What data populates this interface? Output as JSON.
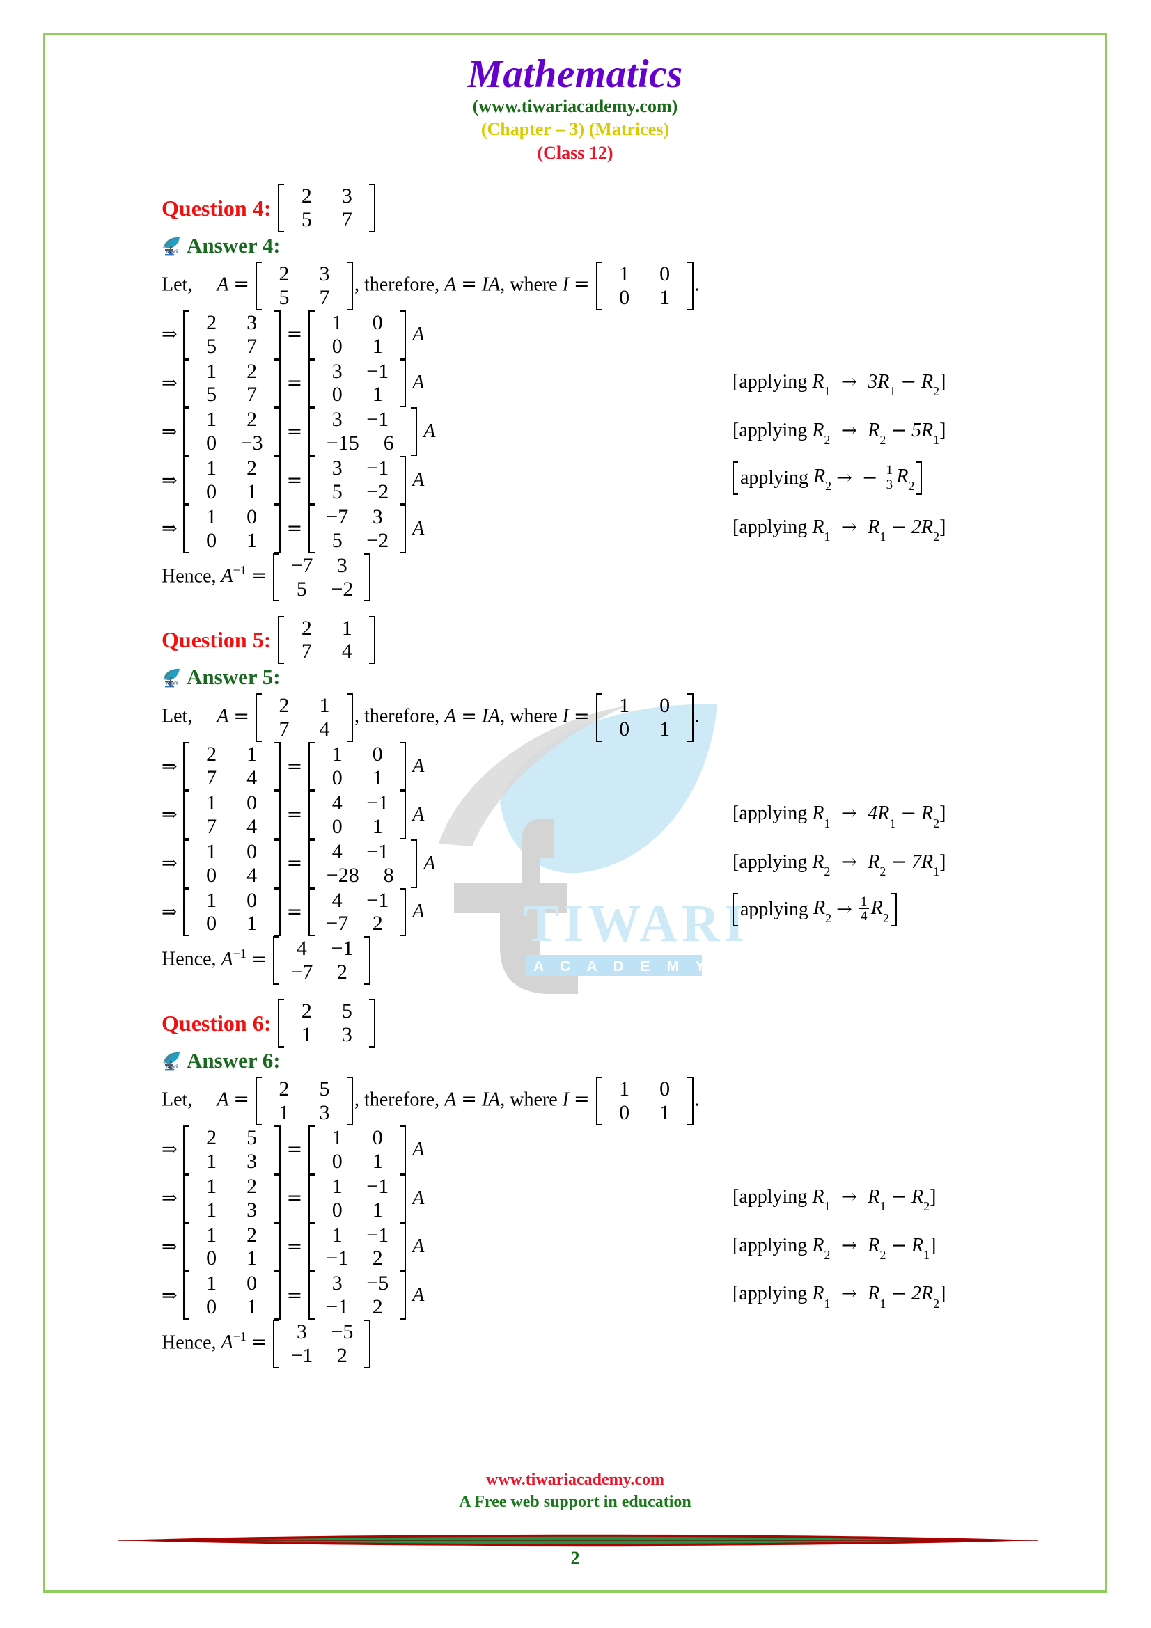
{
  "header": {
    "title": "Mathematics",
    "site": "(www.tiwariacademy.com)",
    "chapter": "(Chapter – 3) (Matrices)",
    "klass": "(Class 12)"
  },
  "colors": {
    "title_purple": "#6600cc",
    "site_green": "#1a6b1a",
    "chapter_yellow": "#d9cb00",
    "class_red": "#e8152b",
    "question_red": "#f01010",
    "answer_green": "#18691f",
    "page_border_green": "#8fce5c",
    "watermark_blue": "#cfeaf7",
    "watermark_gray": "#d4d4d4"
  },
  "watermark": {
    "brand": "TIWARI",
    "sub": "A C A D E M Y"
  },
  "sections": [
    {
      "question_label": "Question 4:",
      "question_matrix": [
        [
          "2",
          "3"
        ],
        [
          "5",
          "7"
        ]
      ],
      "answer_label": "Answer 4:",
      "let_text": "Let,",
      "A_sym": "A",
      "eq": "=",
      "A_matrix": [
        [
          "2",
          "3"
        ],
        [
          "5",
          "7"
        ]
      ],
      "therefore_text": ", therefore,",
      "A_IA": "A = IA",
      "where_text": ", where",
      "I_sym": "I",
      "I_matrix": [
        [
          "1",
          "0"
        ],
        [
          "0",
          "1"
        ]
      ],
      "period": ".",
      "steps": [
        {
          "lhs": [
            [
              "2",
              "3"
            ],
            [
              "5",
              "7"
            ]
          ],
          "rhs": [
            [
              "1",
              "0"
            ],
            [
              "0",
              "1"
            ]
          ],
          "note": null
        },
        {
          "lhs": [
            [
              "1",
              "2"
            ],
            [
              "5",
              "7"
            ]
          ],
          "rhs": [
            [
              "3",
              "−1"
            ],
            [
              "0",
              "1"
            ]
          ],
          "note": {
            "prefix": "[applying ",
            "lhs_var": "R",
            "lhs_sub": "1",
            "arrow": "→",
            "rhs": "3R",
            "rhs_sub": "1",
            "minus": "−",
            "last": "R",
            "last_sub": "2",
            "suffix": "]"
          }
        },
        {
          "lhs": [
            [
              "1",
              "2"
            ],
            [
              "0",
              "−3"
            ]
          ],
          "rhs": [
            [
              "3",
              "−1"
            ],
            [
              "−15",
              "6"
            ]
          ],
          "note": {
            "prefix": "[applying ",
            "lhs_var": "R",
            "lhs_sub": "2",
            "arrow": "→",
            "rhs": "R",
            "rhs_sub": "2",
            "minus": "−",
            "last": "5R",
            "last_sub": "1",
            "suffix": "]"
          }
        },
        {
          "lhs": [
            [
              "1",
              "2"
            ],
            [
              "0",
              "1"
            ]
          ],
          "rhs": [
            [
              "3",
              "−1"
            ],
            [
              "5",
              "−2"
            ]
          ],
          "note_frac": {
            "prefix": "[applying ",
            "lhs_var": "R",
            "lhs_sub": "2",
            "arrow": "→",
            "sign": "−",
            "num": "1",
            "den": "3",
            "last": "R",
            "last_sub": "2",
            "suffix": "]"
          }
        },
        {
          "lhs": [
            [
              "1",
              "0"
            ],
            [
              "0",
              "1"
            ]
          ],
          "rhs": [
            [
              "−7",
              "3"
            ],
            [
              "5",
              "−2"
            ]
          ],
          "note": {
            "prefix": "[applying ",
            "lhs_var": "R",
            "lhs_sub": "1",
            "arrow": "→",
            "rhs": "R",
            "rhs_sub": "1",
            "minus": "−",
            "last": "2R",
            "last_sub": "2",
            "suffix": "]"
          }
        }
      ],
      "hence_text": "Hence,",
      "hence_sym": "A",
      "hence_sup": "−1",
      "hence_eq": "=",
      "hence_matrix": [
        [
          "−7",
          "3"
        ],
        [
          "5",
          "−2"
        ]
      ]
    },
    {
      "question_label": "Question 5:",
      "question_matrix": [
        [
          "2",
          "1"
        ],
        [
          "7",
          "4"
        ]
      ],
      "answer_label": "Answer 5:",
      "let_text": "Let,",
      "A_sym": "A",
      "eq": "=",
      "A_matrix": [
        [
          "2",
          "1"
        ],
        [
          "7",
          "4"
        ]
      ],
      "therefore_text": ", therefore,",
      "A_IA": "A = IA",
      "where_text": ", where",
      "I_sym": "I",
      "I_matrix": [
        [
          "1",
          "0"
        ],
        [
          "0",
          "1"
        ]
      ],
      "period": ".",
      "steps": [
        {
          "lhs": [
            [
              "2",
              "1"
            ],
            [
              "7",
              "4"
            ]
          ],
          "rhs": [
            [
              "1",
              "0"
            ],
            [
              "0",
              "1"
            ]
          ],
          "note": null
        },
        {
          "lhs": [
            [
              "1",
              "0"
            ],
            [
              "7",
              "4"
            ]
          ],
          "rhs": [
            [
              "4",
              "−1"
            ],
            [
              "0",
              "1"
            ]
          ],
          "note": {
            "prefix": "[applying ",
            "lhs_var": "R",
            "lhs_sub": "1",
            "arrow": "→",
            "rhs": "4R",
            "rhs_sub": "1",
            "minus": "−",
            "last": "R",
            "last_sub": "2",
            "suffix": "]"
          }
        },
        {
          "lhs": [
            [
              "1",
              "0"
            ],
            [
              "0",
              "4"
            ]
          ],
          "rhs": [
            [
              "4",
              "−1"
            ],
            [
              "−28",
              "8"
            ]
          ],
          "note": {
            "prefix": "[applying ",
            "lhs_var": "R",
            "lhs_sub": "2",
            "arrow": "→",
            "rhs": "R",
            "rhs_sub": "2",
            "minus": "−",
            "last": "7R",
            "last_sub": "1",
            "suffix": "]"
          }
        },
        {
          "lhs": [
            [
              "1",
              "0"
            ],
            [
              "0",
              "1"
            ]
          ],
          "rhs": [
            [
              "4",
              "−1"
            ],
            [
              "−7",
              "2"
            ]
          ],
          "note_frac": {
            "prefix": "[applying ",
            "lhs_var": "R",
            "lhs_sub": "2",
            "arrow": "→",
            "sign": "",
            "num": "1",
            "den": "4",
            "last": "R",
            "last_sub": "2",
            "suffix": "]"
          }
        }
      ],
      "hence_text": "Hence,",
      "hence_sym": "A",
      "hence_sup": "−1",
      "hence_eq": "=",
      "hence_matrix": [
        [
          "4",
          "−1"
        ],
        [
          "−7",
          "2"
        ]
      ]
    },
    {
      "question_label": "Question 6:",
      "question_matrix": [
        [
          "2",
          "5"
        ],
        [
          "1",
          "3"
        ]
      ],
      "answer_label": "Answer 6:",
      "let_text": "Let,",
      "A_sym": "A",
      "eq": "=",
      "A_matrix": [
        [
          "2",
          "5"
        ],
        [
          "1",
          "3"
        ]
      ],
      "therefore_text": ", therefore,",
      "A_IA": "A = IA",
      "where_text": ", where",
      "I_sym": "I",
      "I_matrix": [
        [
          "1",
          "0"
        ],
        [
          "0",
          "1"
        ]
      ],
      "period": ".",
      "steps": [
        {
          "lhs": [
            [
              "2",
              "5"
            ],
            [
              "1",
              "3"
            ]
          ],
          "rhs": [
            [
              "1",
              "0"
            ],
            [
              "0",
              "1"
            ]
          ],
          "note": null
        },
        {
          "lhs": [
            [
              "1",
              "2"
            ],
            [
              "1",
              "3"
            ]
          ],
          "rhs": [
            [
              "1",
              "−1"
            ],
            [
              "0",
              "1"
            ]
          ],
          "note": {
            "prefix": "[applying ",
            "lhs_var": "R",
            "lhs_sub": "1",
            "arrow": "→",
            "rhs": "R",
            "rhs_sub": "1",
            "minus": "−",
            "last": "R",
            "last_sub": "2",
            "suffix": "]"
          }
        },
        {
          "lhs": [
            [
              "1",
              "2"
            ],
            [
              "0",
              "1"
            ]
          ],
          "rhs": [
            [
              "1",
              "−1"
            ],
            [
              "−1",
              "2"
            ]
          ],
          "note": {
            "prefix": "[applying ",
            "lhs_var": "R",
            "lhs_sub": "2",
            "arrow": "→",
            "rhs": "R",
            "rhs_sub": "2",
            "minus": "−",
            "last": "R",
            "last_sub": "1",
            "suffix": "]"
          }
        },
        {
          "lhs": [
            [
              "1",
              "0"
            ],
            [
              "0",
              "1"
            ]
          ],
          "rhs": [
            [
              "3",
              "−5"
            ],
            [
              "−1",
              "2"
            ]
          ],
          "note": {
            "prefix": "[applying ",
            "lhs_var": "R",
            "lhs_sub": "1",
            "arrow": "→",
            "rhs": "R",
            "rhs_sub": "1",
            "minus": "−",
            "last": "2R",
            "last_sub": "2",
            "suffix": "]"
          }
        }
      ],
      "hence_text": "Hence,",
      "hence_sym": "A",
      "hence_sup": "−1",
      "hence_eq": "=",
      "hence_matrix": [
        [
          "3",
          "−5"
        ],
        [
          "−1",
          "2"
        ]
      ]
    }
  ],
  "footer": {
    "url": "www.tiwariacademy.com",
    "tagline": "A Free web support in education",
    "page_number": "2"
  }
}
